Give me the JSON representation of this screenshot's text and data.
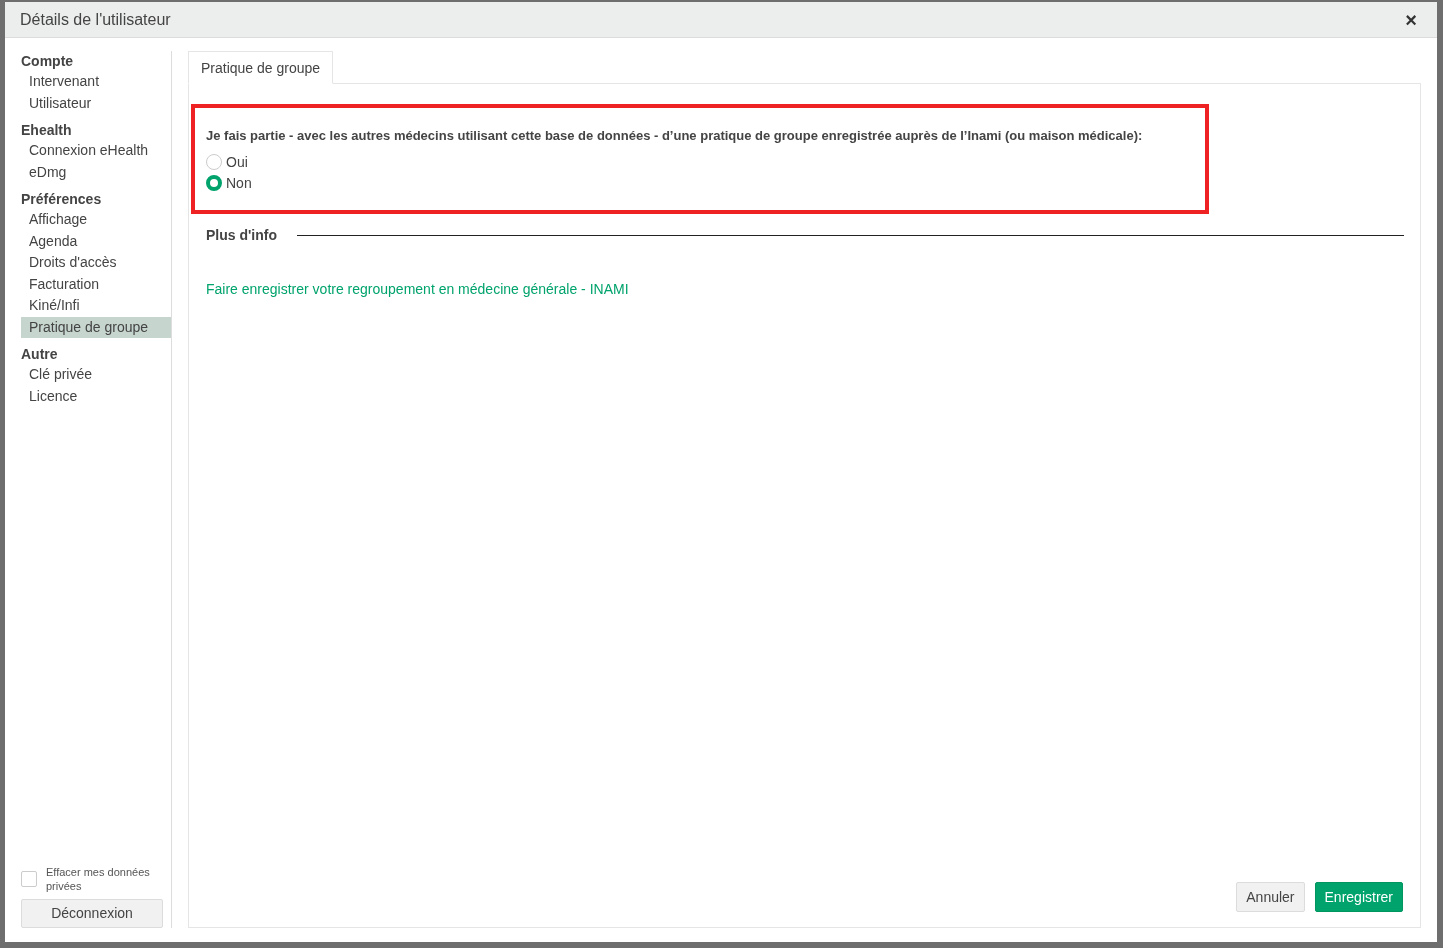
{
  "window": {
    "title": "Détails de l'utilisateur",
    "close": "×"
  },
  "sidebar": {
    "sections": [
      {
        "title": "Compte",
        "items": [
          {
            "label": "Intervenant",
            "selected": false
          },
          {
            "label": "Utilisateur",
            "selected": false
          }
        ]
      },
      {
        "title": "Ehealth",
        "items": [
          {
            "label": "Connexion eHealth",
            "selected": false
          },
          {
            "label": "eDmg",
            "selected": false
          }
        ]
      },
      {
        "title": "Préférences",
        "items": [
          {
            "label": "Affichage",
            "selected": false
          },
          {
            "label": "Agenda",
            "selected": false
          },
          {
            "label": "Droits d'accès",
            "selected": false
          },
          {
            "label": "Facturation",
            "selected": false
          },
          {
            "label": "Kiné/Infi",
            "selected": false
          },
          {
            "label": "Pratique de groupe",
            "selected": true
          }
        ]
      },
      {
        "title": "Autre",
        "items": [
          {
            "label": "Clé privée",
            "selected": false
          },
          {
            "label": "Licence",
            "selected": false
          }
        ]
      }
    ],
    "erase_checkbox": {
      "label": "Effacer mes données privées",
      "checked": false
    },
    "logout_button": "Déconnexion"
  },
  "tabs": [
    {
      "label": "Pratique de groupe",
      "selected": true
    }
  ],
  "question": {
    "text": "Je fais partie - avec les autres médecins utilisant cette base de données - d’une pratique de groupe enregistrée auprès de l’Inami (ou maison médicale):",
    "options": [
      {
        "label": "Oui",
        "selected": false
      },
      {
        "label": "Non",
        "selected": true
      }
    ]
  },
  "more_info": {
    "title": "Plus d'info",
    "link": "Faire enregistrer votre regroupement en médecine générale - INAMI"
  },
  "buttons": {
    "cancel": "Annuler",
    "save": "Enregistrer"
  }
}
